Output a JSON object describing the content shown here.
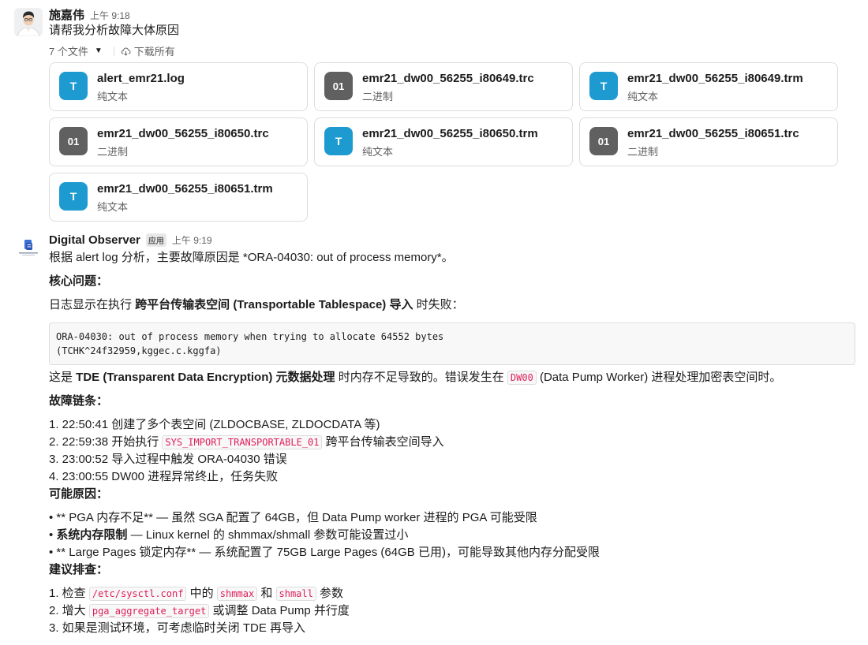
{
  "msg1": {
    "sender": "施嘉伟",
    "time": "上午 9:18",
    "text": "请帮我分析故障大体原因",
    "files_count": "7 个文件",
    "download_all": "下载所有",
    "files": [
      {
        "name": "alert_emr21.log",
        "type": "纯文本",
        "icon": "T"
      },
      {
        "name": "emr21_dw00_56255_i80649.trc",
        "type": "二进制",
        "icon": "01"
      },
      {
        "name": "emr21_dw00_56255_i80649.trm",
        "type": "纯文本",
        "icon": "T"
      },
      {
        "name": "emr21_dw00_56255_i80650.trc",
        "type": "二进制",
        "icon": "01"
      },
      {
        "name": "emr21_dw00_56255_i80650.trm",
        "type": "纯文本",
        "icon": "T"
      },
      {
        "name": "emr21_dw00_56255_i80651.trc",
        "type": "二进制",
        "icon": "01"
      },
      {
        "name": "emr21_dw00_56255_i80651.trm",
        "type": "纯文本",
        "icon": "T"
      }
    ]
  },
  "msg2": {
    "sender": "Digital Observer",
    "badge": "应用",
    "time": "上午 9:19",
    "intro": "根据 alert log 分析，主要故障原因是 *ORA-04030: out of process memory*。",
    "h_core": "核心问题：",
    "core_pre": "日志显示在执行 ",
    "core_bold": "跨平台传输表空间 (Transportable Tablespace) 导入",
    "core_post": " 时失败：",
    "code_line1": "ORA-04030: out of process memory when trying to allocate 64552 bytes",
    "code_line2": "(TCHK^24f32959,kggec.c.kggfa)",
    "tde_pre": "这是 ",
    "tde_bold": "TDE (Transparent Data Encryption) 元数据处理",
    "tde_mid": " 时内存不足导致的。错误发生在 ",
    "tde_code": "DW00",
    "tde_post": " (Data Pump Worker) 进程处理加密表空间时。",
    "h_chain": "故障链条：",
    "chain1": "1. 22:50:41 创建了多个表空间 (ZLDOCBASE, ZLDOCDATA 等)",
    "chain2_pre": "2. 22:59:38 开始执行 ",
    "chain2_code": "SYS_IMPORT_TRANSPORTABLE_01",
    "chain2_post": " 跨平台传输表空间导入",
    "chain3": "3. 23:00:52 导入过程中触发 ORA-04030 错误",
    "chain4": "4. 23:00:55 DW00 进程异常终止，任务失败",
    "h_causes": "可能原因：",
    "cause1": "• ** PGA 内存不足** — 虽然 SGA 配置了 64GB，但 Data Pump worker 进程的 PGA 可能受限",
    "cause2_bullet": "• ",
    "cause2_bold": "系统内存限制",
    "cause2_post": " — Linux kernel 的 shmmax/shmall 参数可能设置过小",
    "cause3": "• ** Large Pages 锁定内存** — 系统配置了 75GB Large Pages (64GB 已用)，可能导致其他内存分配受限",
    "h_check": "建议排查：",
    "check1_pre": "1. 检查 ",
    "check1_code1": "/etc/sysctl.conf",
    "check1_mid1": " 中的 ",
    "check1_code2": "shmmax",
    "check1_mid2": " 和 ",
    "check1_code3": "shmall",
    "check1_post": " 参数",
    "check2_pre": "2. 增大 ",
    "check2_code": "pga_aggregate_target",
    "check2_post": " 或调整 Data Pump 并行度",
    "check3": "3. 如果是测试环境，可考虑临时关闭 TDE 再导入"
  }
}
